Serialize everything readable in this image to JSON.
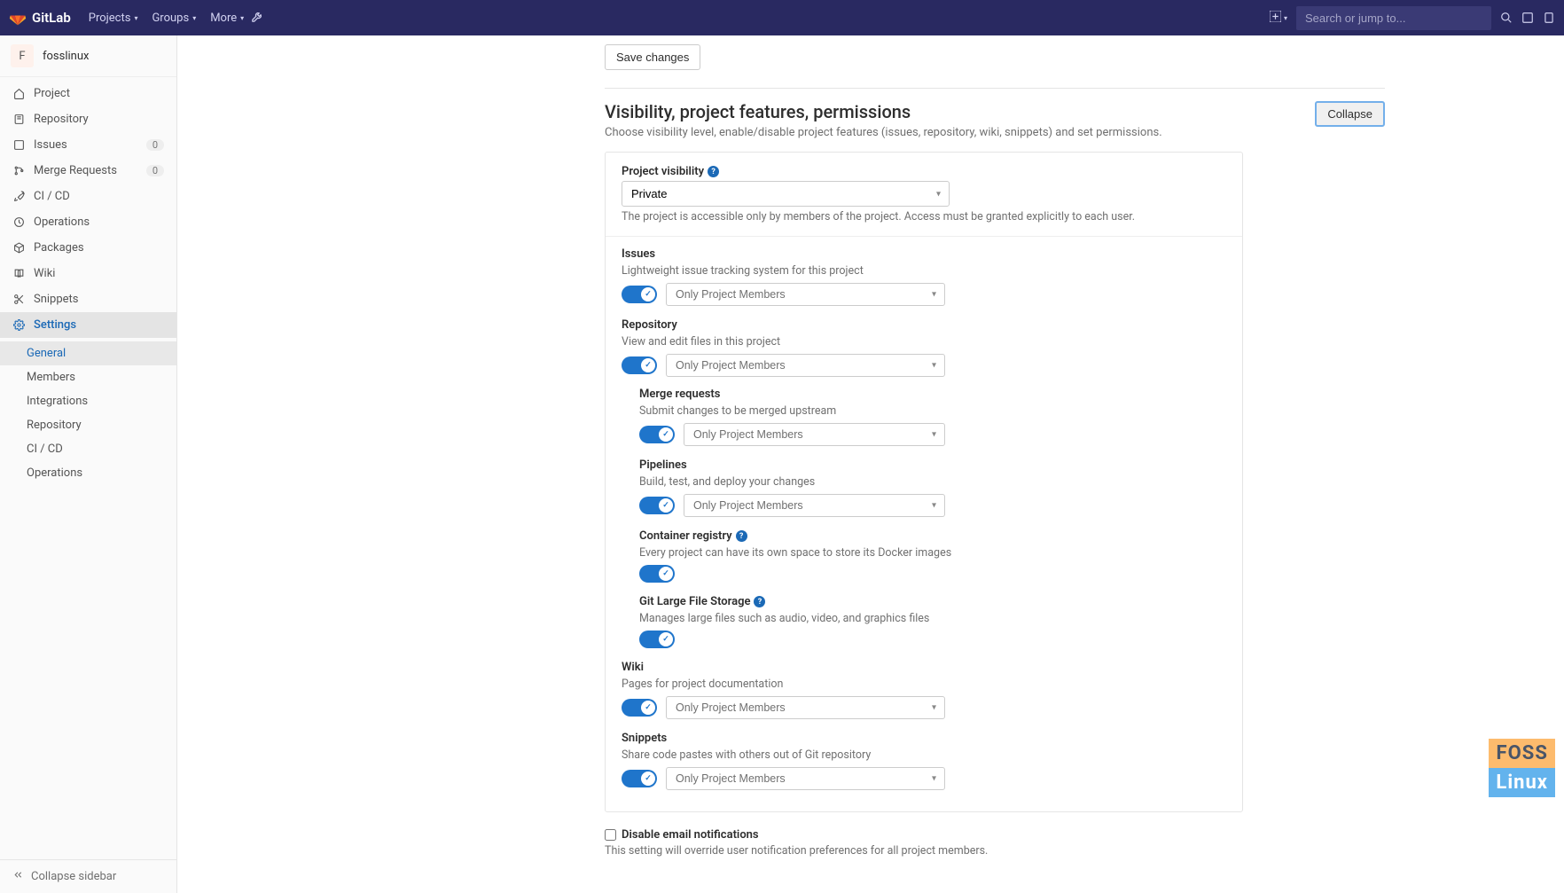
{
  "brand": "GitLab",
  "nav": {
    "projects": "Projects",
    "groups": "Groups",
    "more": "More"
  },
  "search_placeholder": "Search or jump to...",
  "project": {
    "avatar_letter": "F",
    "name": "fosslinux"
  },
  "sidebar": {
    "items": [
      {
        "label": "Project"
      },
      {
        "label": "Repository"
      },
      {
        "label": "Issues",
        "badge": "0"
      },
      {
        "label": "Merge Requests",
        "badge": "0"
      },
      {
        "label": "CI / CD"
      },
      {
        "label": "Operations"
      },
      {
        "label": "Packages"
      },
      {
        "label": "Wiki"
      },
      {
        "label": "Snippets"
      },
      {
        "label": "Settings"
      }
    ],
    "sub": [
      {
        "label": "General"
      },
      {
        "label": "Members"
      },
      {
        "label": "Integrations"
      },
      {
        "label": "Repository"
      },
      {
        "label": "CI / CD"
      },
      {
        "label": "Operations"
      }
    ],
    "collapse": "Collapse sidebar"
  },
  "actions": {
    "save": "Save changes",
    "collapse": "Collapse"
  },
  "section": {
    "title": "Visibility, project features, permissions",
    "desc": "Choose visibility level, enable/disable project features (issues, repository, wiki, snippets) and set permissions."
  },
  "visibility": {
    "label": "Project visibility",
    "value": "Private",
    "hint": "The project is accessible only by members of the project. Access must be granted explicitly to each user."
  },
  "features": {
    "access_option": "Only Project Members",
    "issues": {
      "label": "Issues",
      "hint": "Lightweight issue tracking system for this project"
    },
    "repository": {
      "label": "Repository",
      "hint": "View and edit files in this project"
    },
    "merge_requests": {
      "label": "Merge requests",
      "hint": "Submit changes to be merged upstream"
    },
    "pipelines": {
      "label": "Pipelines",
      "hint": "Build, test, and deploy your changes"
    },
    "container_registry": {
      "label": "Container registry",
      "hint": "Every project can have its own space to store its Docker images"
    },
    "git_lfs": {
      "label": "Git Large File Storage",
      "hint": "Manages large files such as audio, video, and graphics files"
    },
    "wiki": {
      "label": "Wiki",
      "hint": "Pages for project documentation"
    },
    "snippets": {
      "label": "Snippets",
      "hint": "Share code pastes with others out of Git repository"
    }
  },
  "email_notif": {
    "label": "Disable email notifications",
    "hint": "This setting will override user notification preferences for all project members."
  },
  "watermark": {
    "top": "FOSS",
    "bottom": "Linux"
  }
}
